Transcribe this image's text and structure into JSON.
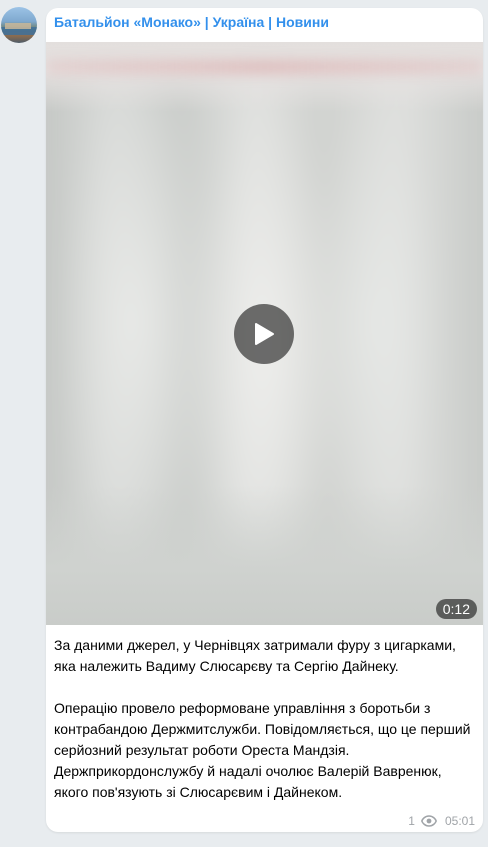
{
  "channel": {
    "name": "Батальйон «Монако» | Україна | Новини"
  },
  "video": {
    "duration": "0:12"
  },
  "message": {
    "paragraphs": [
      "За даними джерел, у Чернівцях затримали фуру з цигарками, яка належить Вадиму Слюсарєву та Сергію Дайнеку.",
      "Операцію провело реформоване управління з боротьби з контрабандою Держмитслужби. Повідомляється, що це перший серйозний результат роботи Ореста Мандзія. Держприкордонслужбу й надалі очолює Валерій Вавренюк, якого пов'язують зі Слюсарєвим і Дайнеком."
    ],
    "views": "1",
    "time": "05:01"
  },
  "icons": {
    "play": "play-icon",
    "views": "eye-icon"
  },
  "colors": {
    "accent": "#3390ec",
    "background": "#e8ecef",
    "bubble": "#ffffff",
    "meta": "#a0a4a8"
  }
}
